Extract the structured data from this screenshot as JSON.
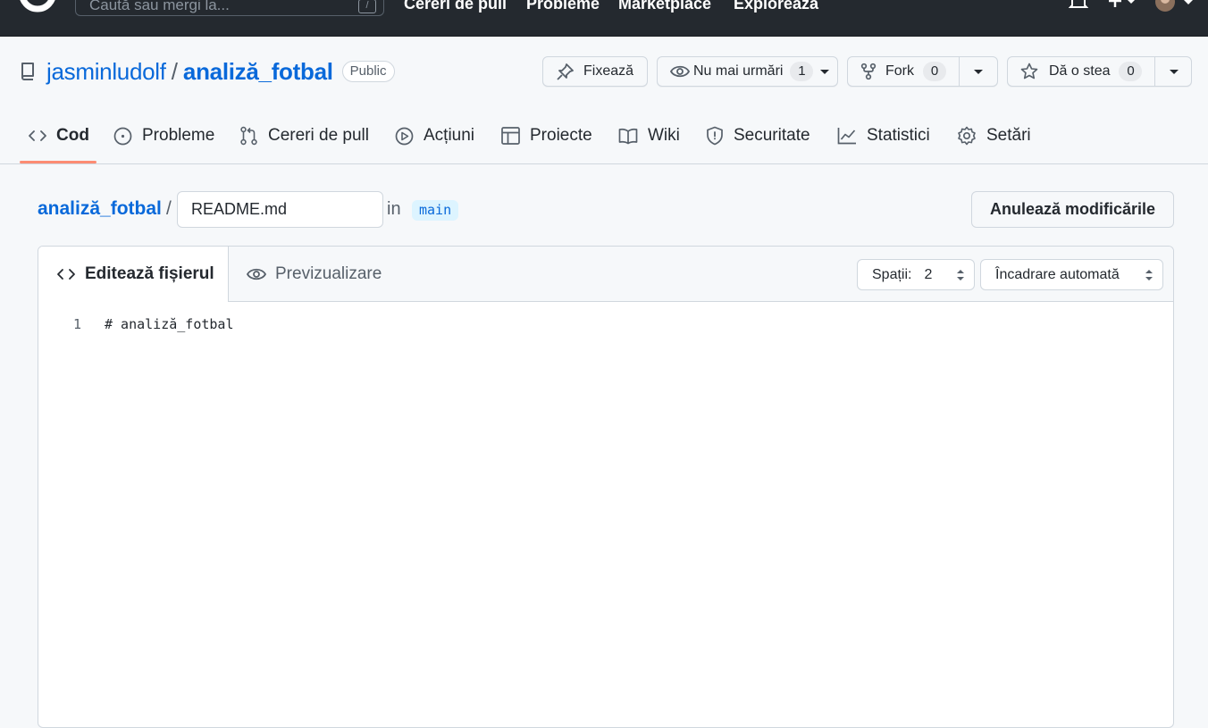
{
  "header": {
    "search_placeholder": "Caută sau mergi la...",
    "search_shortcut": "/",
    "nav": [
      "Cereri de pull",
      "Probleme",
      "Marketplace",
      "Explorează"
    ]
  },
  "repo": {
    "owner": "jasminludolf",
    "separator": "/",
    "name": "analiză_fotbal",
    "visibility": "Public",
    "actions": {
      "pin_label": "Fixează",
      "watch_label": "Nu mai urmări",
      "watch_count": "1",
      "fork_label": "Fork",
      "fork_count": "0",
      "star_label": "Dă o stea",
      "star_count": "0"
    }
  },
  "tabs": [
    {
      "label": "Cod",
      "icon": "code-icon",
      "active": true
    },
    {
      "label": "Probleme",
      "icon": "issue-icon"
    },
    {
      "label": "Cereri de pull",
      "icon": "pull-request-icon"
    },
    {
      "label": "Acțiuni",
      "icon": "play-icon"
    },
    {
      "label": "Proiecte",
      "icon": "table-icon"
    },
    {
      "label": "Wiki",
      "icon": "book-icon"
    },
    {
      "label": "Securitate",
      "icon": "shield-icon"
    },
    {
      "label": "Statistici",
      "icon": "graph-icon"
    },
    {
      "label": "Setări",
      "icon": "gear-icon"
    }
  ],
  "editor": {
    "breadcrumb_repo": "analiză_fotbal",
    "breadcrumb_sep": "/",
    "filename": "README.md",
    "in_label": "in",
    "branch": "main",
    "cancel_label": "Anulează modificările",
    "edit_tab": "Editează fișierul",
    "preview_tab": "Previzualizare",
    "indent_label": "Spații:",
    "indent_value": "2",
    "wrap_label": "Încadrare automată",
    "lines": [
      {
        "number": "1",
        "text": "# analiză_fotbal"
      }
    ]
  },
  "colors": {
    "header_bg": "#24292f",
    "link": "#0969da",
    "active_tab_underline": "#fd8c73",
    "branch_bg": "#ddf4ff"
  }
}
